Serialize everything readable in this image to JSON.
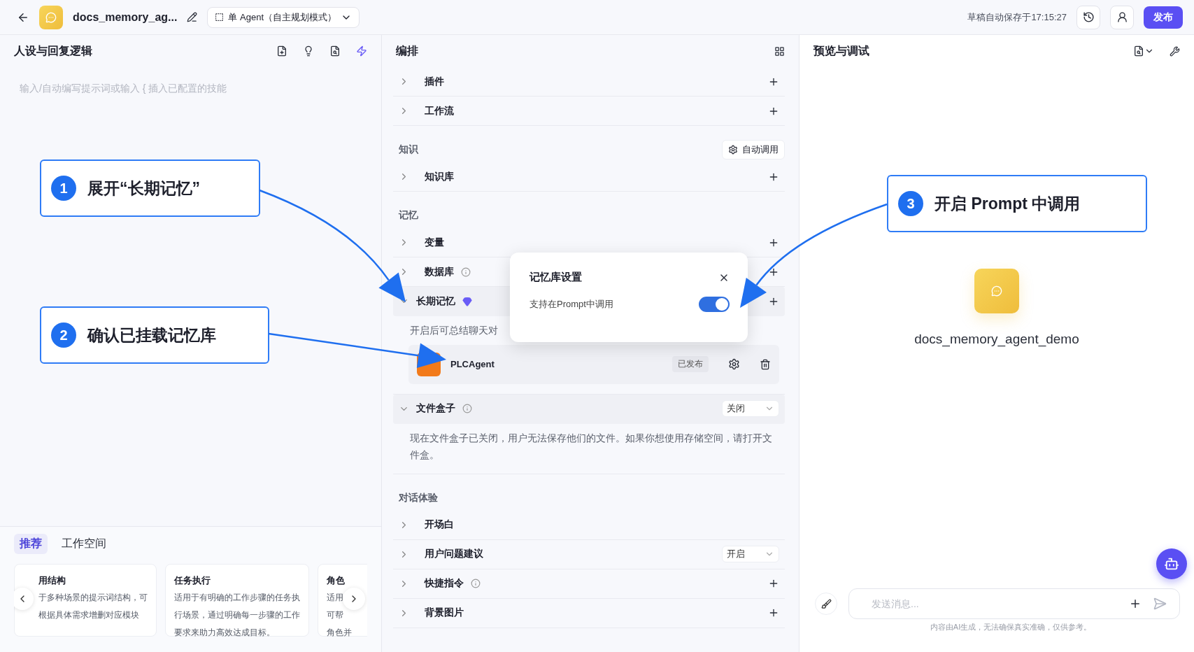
{
  "topbar": {
    "app_name": "docs_memory_ag...",
    "mode": "单 Agent（自主规划模式）",
    "autosave": "草稿自动保存于17:15:27",
    "publish": "发布"
  },
  "left_panel": {
    "title": "人设与回复逻辑",
    "placeholder": "输入/自动编写提示词或输入 { 插入已配置的技能",
    "tabs": [
      {
        "label": "推荐",
        "selected": true
      },
      {
        "label": "工作空间",
        "selected": false
      }
    ],
    "cards": [
      {
        "title": "用结构",
        "lines": [
          "于多种场景的提示词结构，可",
          "根据具体需求增删对应模块"
        ]
      },
      {
        "title": "任务执行",
        "lines": [
          "适用于有明确的工作步骤的任务执",
          "行场景，通过明确每一步骤的工作",
          "要求来助力高效达成目标。"
        ]
      },
      {
        "title": "角色",
        "lines": [
          "适用",
          "可帮",
          "角色并"
        ]
      }
    ]
  },
  "middle_panel": {
    "title": "编排",
    "sections": [
      {
        "items": [
          {
            "label": "插件",
            "expanded": false,
            "info": false,
            "trailing": {
              "kind": "add"
            }
          },
          {
            "label": "工作流",
            "expanded": false,
            "info": false,
            "trailing": {
              "kind": "add"
            }
          }
        ]
      },
      {
        "title": "知识",
        "action": "自动调用",
        "items": [
          {
            "label": "知识库",
            "expanded": false,
            "info": false,
            "trailing": {
              "kind": "add"
            }
          }
        ]
      },
      {
        "title": "记忆",
        "items": [
          {
            "label": "变量",
            "expanded": false,
            "info": false,
            "trailing": {
              "kind": "add"
            }
          },
          {
            "label": "数据库",
            "expanded": false,
            "info": true,
            "trailing": {
              "kind": "add"
            }
          },
          {
            "label": "长期记忆",
            "expanded": true,
            "info": false,
            "premium": true,
            "trailing": {
              "kind": "add"
            },
            "description": "开启后可总结聊天对",
            "agents": [
              {
                "name": "PLCAgent",
                "status": "已发布"
              }
            ]
          },
          {
            "label": "文件盒子",
            "expanded": true,
            "info": true,
            "trailing": {
              "kind": "select",
              "value": "关闭"
            },
            "description": "现在文件盒子已关闭，用户无法保存他们的文件。如果你想使用存储空间，请打开文件盒。"
          }
        ]
      },
      {
        "title": "对话体验",
        "items": [
          {
            "label": "开场白",
            "expanded": false,
            "info": false,
            "trailing": {
              "kind": "none"
            }
          },
          {
            "label": "用户问题建议",
            "expanded": false,
            "info": false,
            "trailing": {
              "kind": "select",
              "value": "开启"
            }
          },
          {
            "label": "快捷指令",
            "expanded": false,
            "info": true,
            "trailing": {
              "kind": "add"
            }
          },
          {
            "label": "背景图片",
            "expanded": false,
            "info": false,
            "trailing": {
              "kind": "add"
            }
          }
        ]
      }
    ]
  },
  "popup": {
    "title": "记忆库设置",
    "option": "支持在Prompt中调用",
    "on": true
  },
  "right_panel": {
    "title": "预览与调试",
    "agent_name": "docs_memory_agent_demo",
    "input_placeholder": "发送消息...",
    "disclaimer": "内容由AI生成，无法确保真实准确，仅供参考。"
  },
  "callouts": [
    {
      "number": "1",
      "text": "展开“长期记忆”"
    },
    {
      "number": "2",
      "text": "确认已挂载记忆库"
    },
    {
      "number": "3",
      "text": "开启 Prompt 中调用"
    }
  ]
}
